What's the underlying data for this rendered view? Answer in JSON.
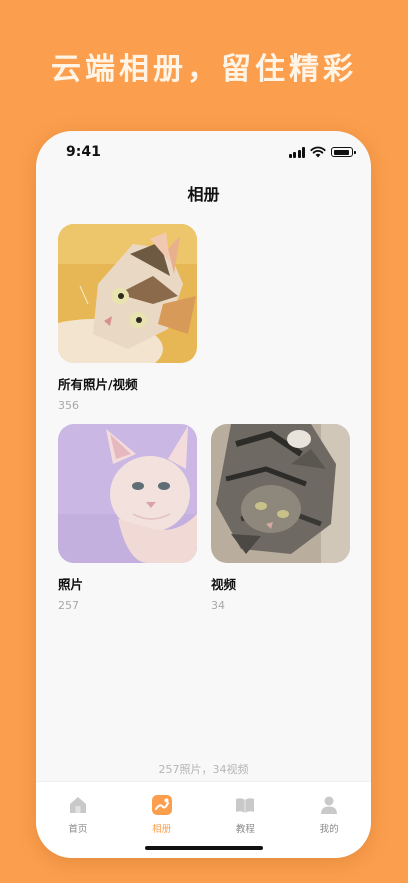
{
  "headline": "云端相册，留住精彩",
  "status": {
    "time": "9:41"
  },
  "page_title": "相册",
  "albums": [
    {
      "name": "所有照片/视频",
      "count": "356"
    },
    {
      "name": "照片",
      "count": "257"
    },
    {
      "name": "视频",
      "count": "34"
    }
  ],
  "summary": "257照片，34视频",
  "tabs": [
    {
      "label": "首页",
      "icon": "home-icon",
      "active": false
    },
    {
      "label": "相册",
      "icon": "album-icon",
      "active": true
    },
    {
      "label": "教程",
      "icon": "book-icon",
      "active": false
    },
    {
      "label": "我的",
      "icon": "user-icon",
      "active": false
    }
  ],
  "colors": {
    "background": "#FB9F4E",
    "accent": "#FB9F4E",
    "tab_inactive": "#C9C9C9"
  }
}
